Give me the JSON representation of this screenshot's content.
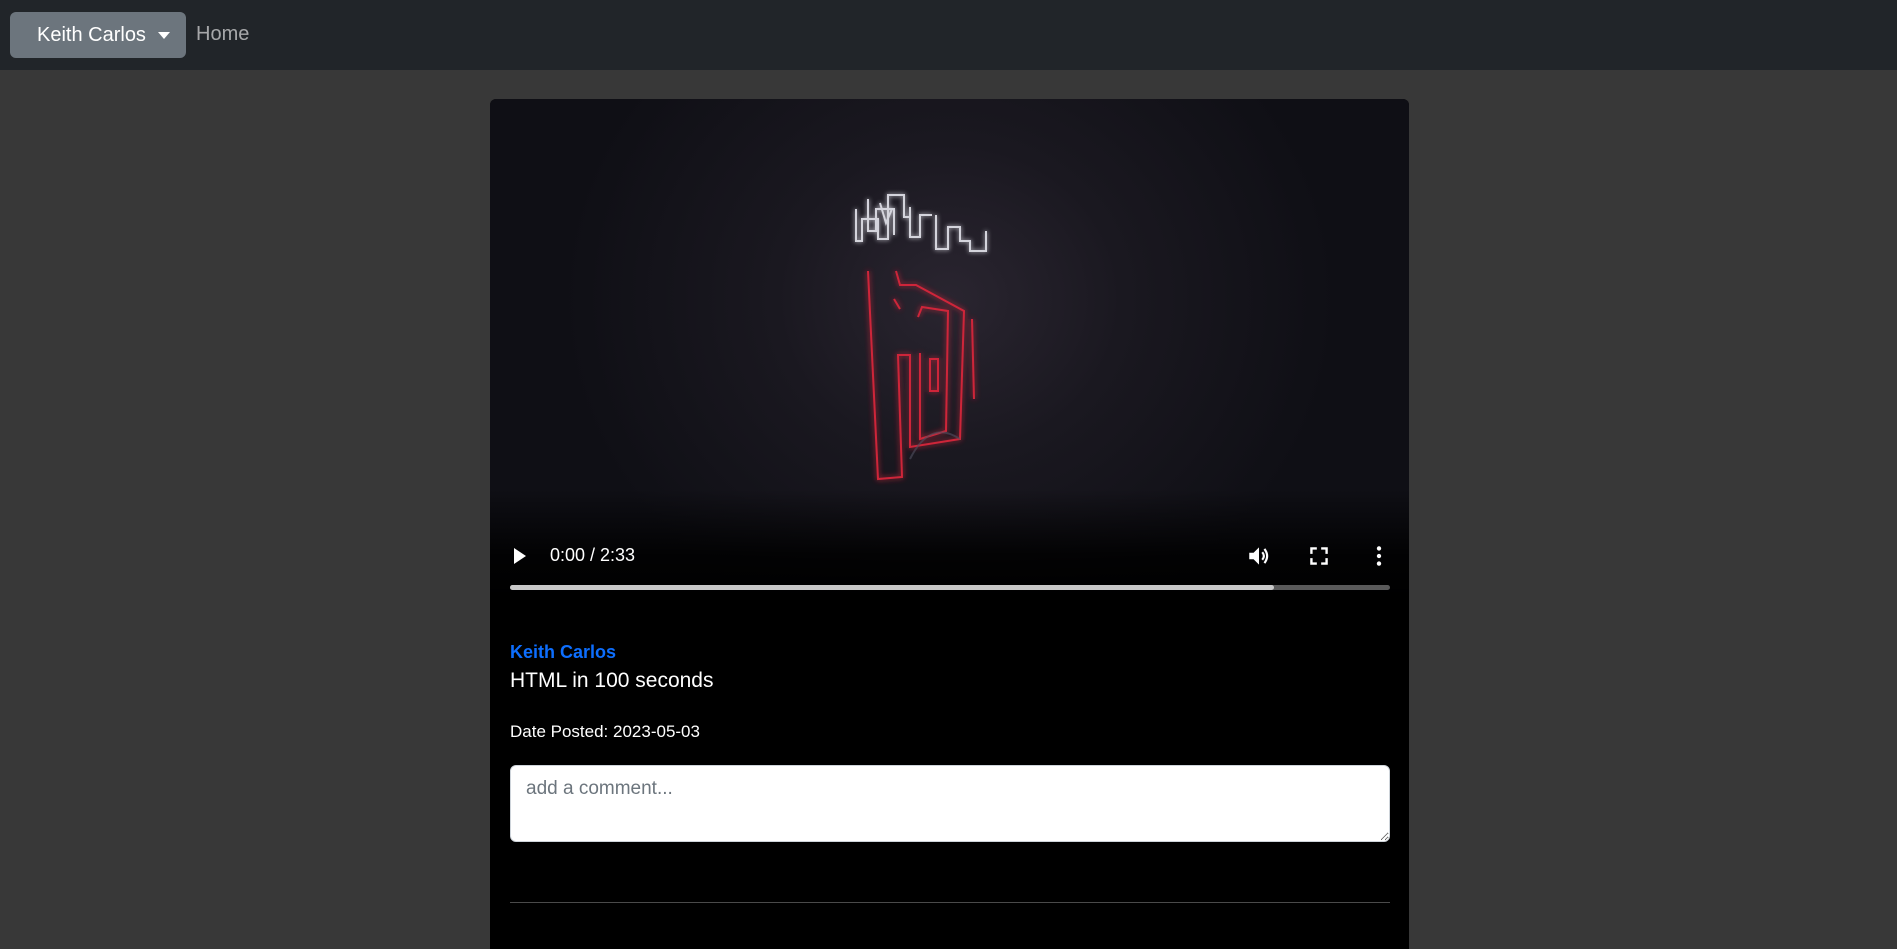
{
  "navbar": {
    "user_name": "Keith Carlos",
    "home_label": "Home"
  },
  "video": {
    "time_display": "0:00 / 2:33",
    "buffered_fraction": 0.868
  },
  "post": {
    "author": "Keith Carlos",
    "title": "HTML in 100 seconds",
    "date_label": "Date Posted: 2023-05-03"
  },
  "comment": {
    "placeholder": "add a comment..."
  },
  "colors": {
    "navbar_bg": "#212529",
    "page_bg": "#383838",
    "dropdown_bg": "#6c757d",
    "author_link": "#0d6efd"
  },
  "icons": [
    "caret-down-icon",
    "play-icon",
    "volume-icon",
    "fullscreen-icon",
    "more-options-icon"
  ]
}
